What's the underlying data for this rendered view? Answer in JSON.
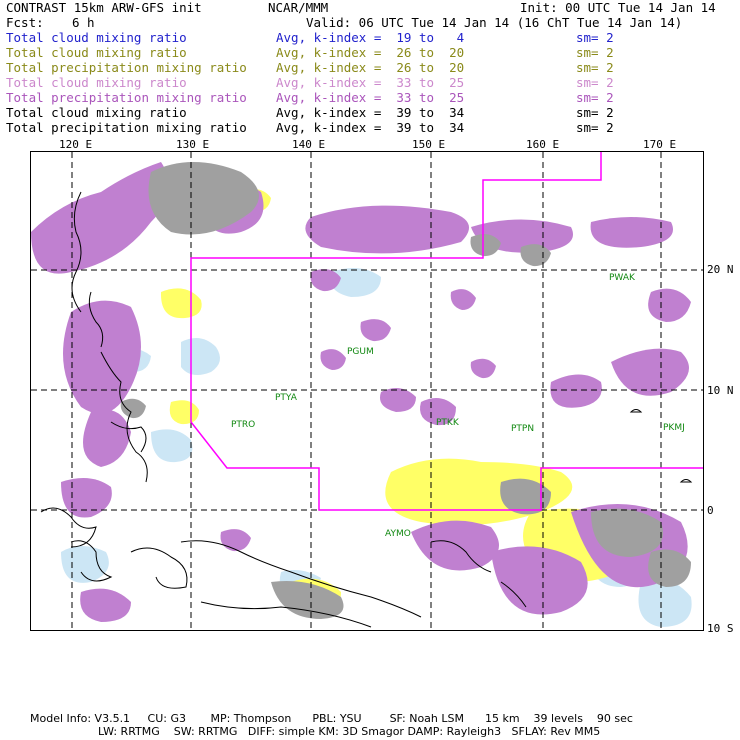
{
  "header": {
    "title": "CONTRAST 15km ARW-GFS init",
    "org": "NCAR/MMM",
    "init": "Init: 00 UTC Tue 14 Jan 14",
    "fcst_label": "Fcst:",
    "fcst_value": "6 h",
    "valid": "Valid: 06 UTC Tue 14 Jan 14 (16 ChT Tue 14 Jan 14)",
    "fields": [
      {
        "label": "Total cloud mixing ratio",
        "avg": "Avg, k-index =  19 to   4",
        "sm": "sm= 2",
        "color": "#2222cc"
      },
      {
        "label": "Total cloud mixing ratio",
        "avg": "Avg, k-index =  26 to  20",
        "sm": "sm= 2",
        "color": "#8a8a1a"
      },
      {
        "label": "Total precipitation mixing ratio",
        "avg": "Avg, k-index =  26 to  20",
        "sm": "sm= 2",
        "color": "#8a8a1a"
      },
      {
        "label": "Total cloud mixing ratio",
        "avg": "Avg, k-index =  33 to  25",
        "sm": "sm= 2",
        "color": "#cc88cc"
      },
      {
        "label": "Total precipitation mixing ratio",
        "avg": "Avg, k-index =  33 to  25",
        "sm": "sm= 2",
        "color": "#aa55bb"
      },
      {
        "label": "Total cloud mixing ratio",
        "avg": "Avg, k-index =  39 to  34",
        "sm": "sm= 2",
        "color": "#000000"
      },
      {
        "label": "Total precipitation mixing ratio",
        "avg": "Avg, k-index =  39 to  34",
        "sm": "sm= 2",
        "color": "#000000"
      }
    ]
  },
  "map": {
    "lon_labels": [
      "120 E",
      "130 E",
      "140 E",
      "150 E",
      "160 E",
      "170 E"
    ],
    "lat_labels": [
      "20 N",
      "10 N",
      "0",
      "10 S"
    ],
    "stations": [
      {
        "id": "PGUM"
      },
      {
        "id": "PTYA"
      },
      {
        "id": "PTRO"
      },
      {
        "id": "PTKK"
      },
      {
        "id": "PTPN"
      },
      {
        "id": "PKMJ"
      },
      {
        "id": "PWAK"
      },
      {
        "id": "AYMO"
      }
    ],
    "colors": {
      "cloud_light": "#cce6f5",
      "cloud_yellow": "#ffff66",
      "cloud_purple": "#c080d0",
      "precip_purple": "#a655b8",
      "heavy": "#a0a0a0",
      "boundary": "#ff00ff"
    }
  },
  "footer": {
    "line1": "Model Info: V3.5.1     CU: G3       MP: Thompson      PBL: YSU        SF: Noah LSM      15 km    39 levels    90 sec",
    "line2": "LW: RRTMG    SW: RRTMG   DIFF: simple KM: 3D Smagor DAMP: Rayleigh3   SFLAY: Rev MM5"
  }
}
